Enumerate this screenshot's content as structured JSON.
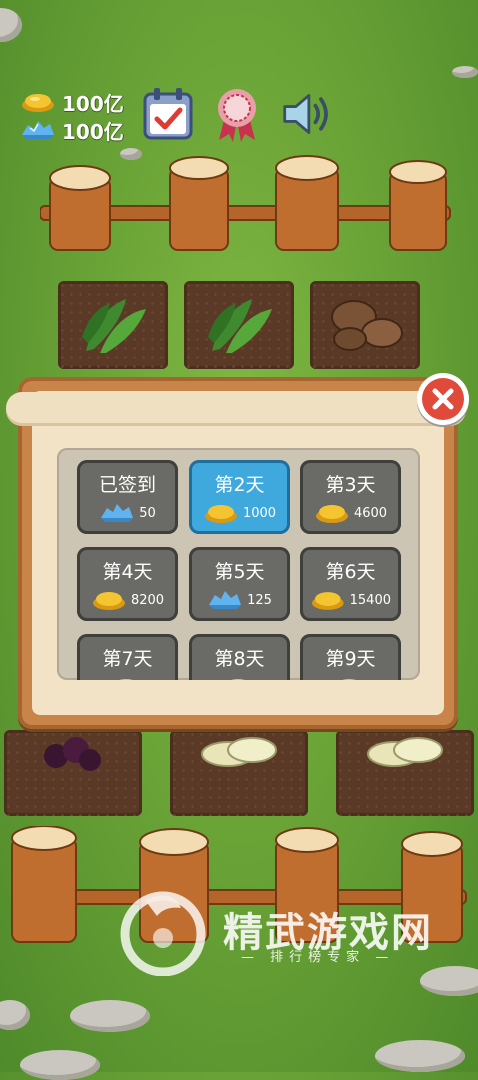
{
  "resources": {
    "gold": {
      "icon": "gold-ingot-icon",
      "value": "100亿"
    },
    "crystal": {
      "icon": "crystal-icon",
      "value": "100亿"
    }
  },
  "top_icons": [
    "calendar-check-icon",
    "award-ribbon-icon",
    "speaker-icon"
  ],
  "crops": {
    "row1": [
      "spinach-icon",
      "spinach-icon",
      "mushroom-icon"
    ],
    "row3": [
      "grape-icon",
      "cabbage-icon",
      "cabbage-icon"
    ]
  },
  "sign_in_dialog": {
    "close_icon": "close-icon",
    "days": [
      {
        "title": "已签到",
        "reward_icon": "crystal-icon",
        "amount": "50",
        "state": "claimed"
      },
      {
        "title": "第2天",
        "reward_icon": "gold-ingot-icon",
        "amount": "1000",
        "state": "active"
      },
      {
        "title": "第3天",
        "reward_icon": "gold-ingot-icon",
        "amount": "4600",
        "state": "locked"
      },
      {
        "title": "第4天",
        "reward_icon": "gold-ingot-icon",
        "amount": "8200",
        "state": "locked"
      },
      {
        "title": "第5天",
        "reward_icon": "crystal-icon",
        "amount": "125",
        "state": "locked"
      },
      {
        "title": "第6天",
        "reward_icon": "gold-ingot-icon",
        "amount": "15400",
        "state": "locked"
      },
      {
        "title": "第7天",
        "reward_icon": "gold-ingot-icon",
        "amount": "",
        "state": "locked"
      },
      {
        "title": "第8天",
        "reward_icon": "gold-ingot-icon",
        "amount": "",
        "state": "locked"
      },
      {
        "title": "第9天",
        "reward_icon": "gold-ingot-icon",
        "amount": "",
        "state": "locked"
      }
    ]
  },
  "watermark": {
    "title": "精武游戏网",
    "subtitle": "— 排行榜专家 —"
  },
  "colors": {
    "active_card": "#3fa9dd",
    "card": "#6a6a66",
    "close_red": "#e04a3a",
    "wood": "#c9844a"
  }
}
